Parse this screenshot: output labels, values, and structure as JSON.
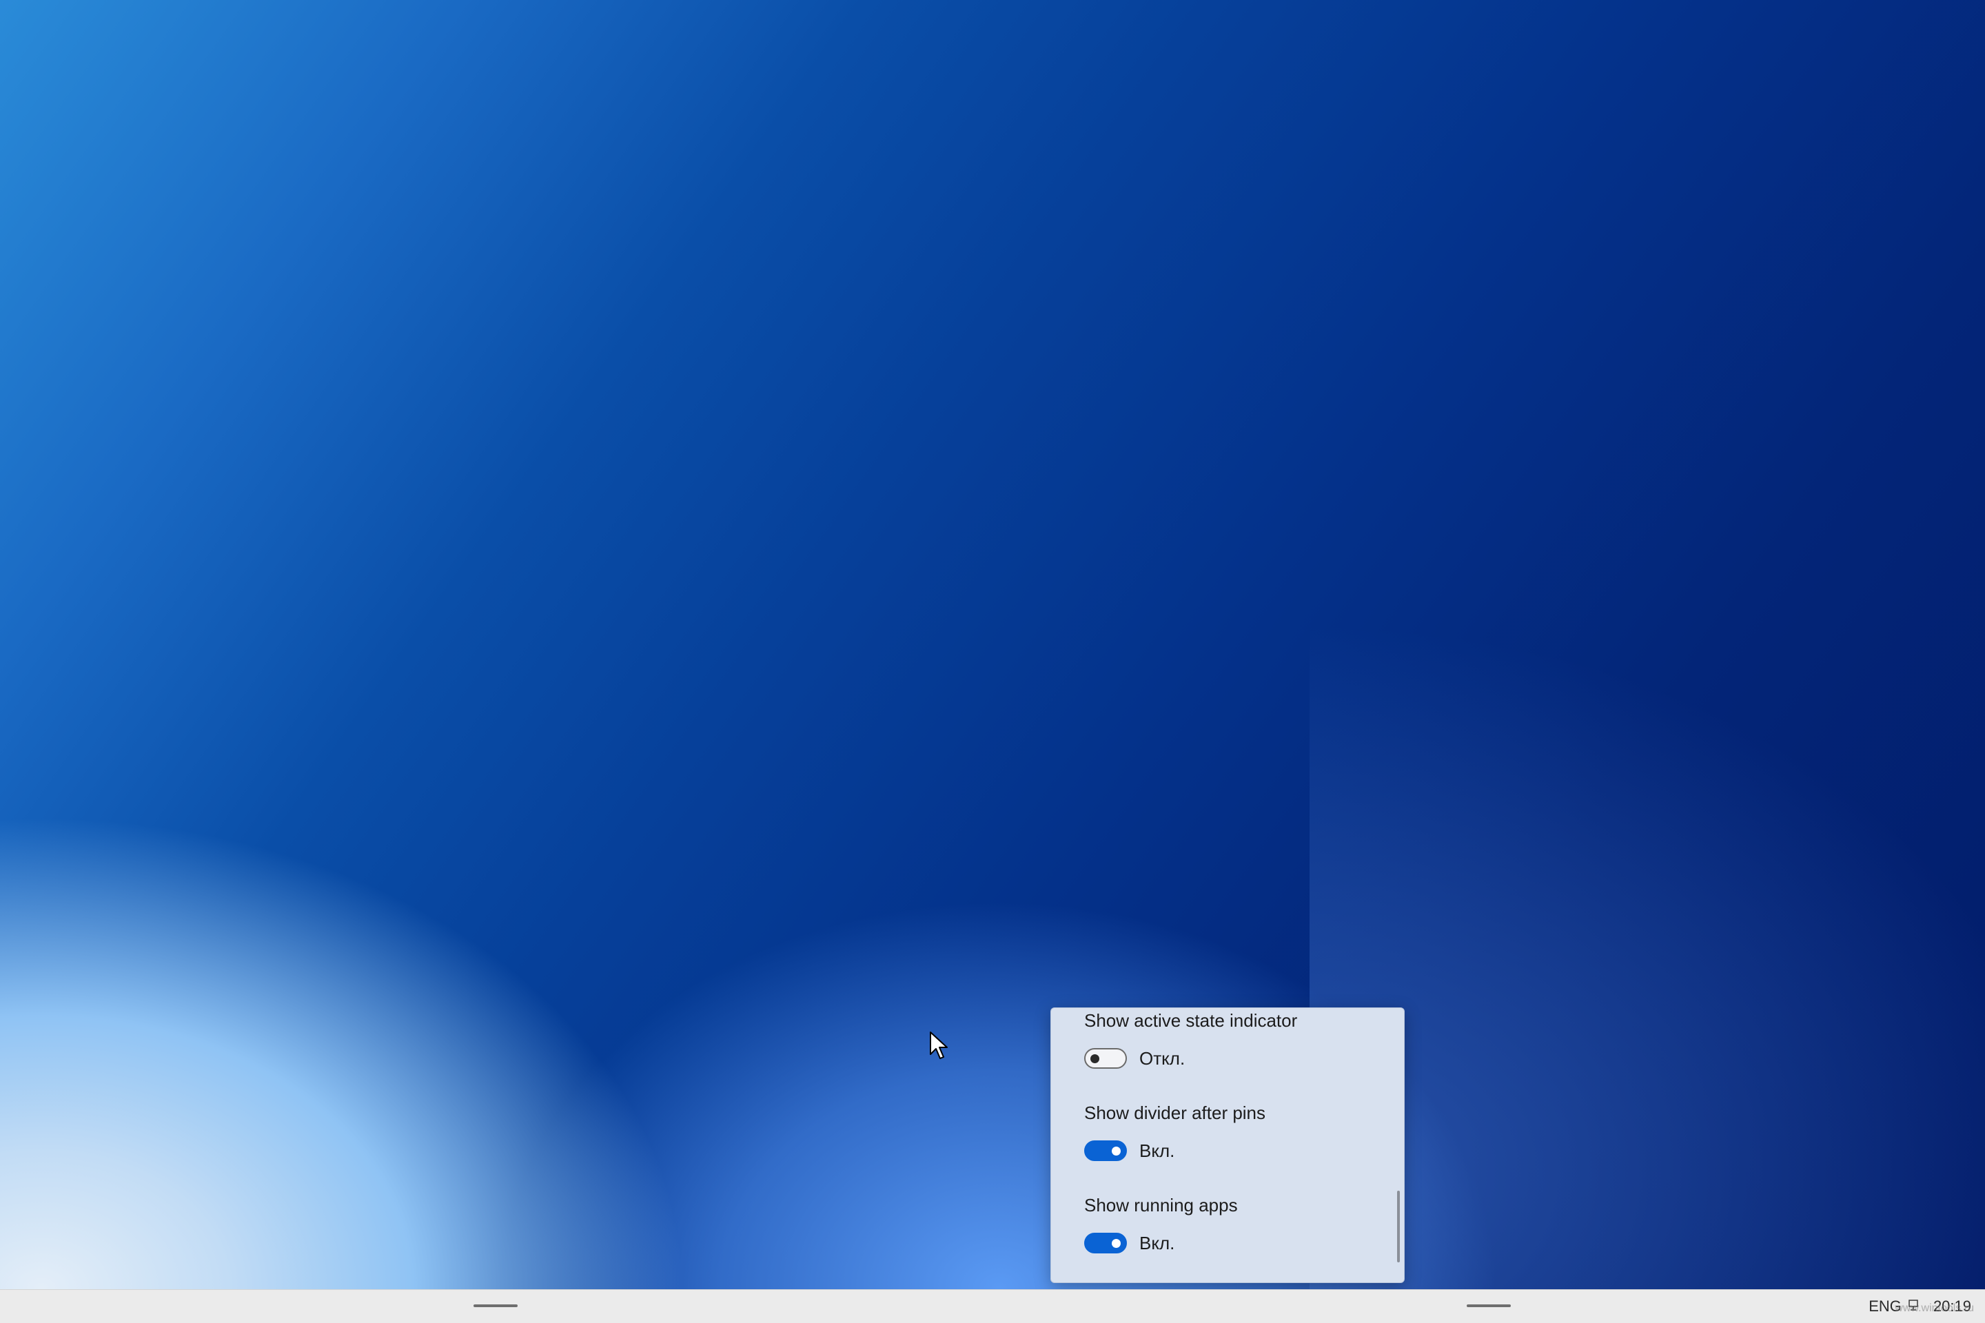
{
  "flyout": {
    "settings": [
      {
        "title": "Show active state indicator",
        "state": "off",
        "state_label": "Откл."
      },
      {
        "title": "Show divider after pins",
        "state": "on",
        "state_label": "Вкл."
      },
      {
        "title": "Show running apps",
        "state": "on",
        "state_label": "Вкл."
      }
    ]
  },
  "taskbar": {
    "language": "ENG",
    "network_icon": "network-icon",
    "time": "20:19",
    "watermark": "www.wintools.ru"
  },
  "colors": {
    "toggle_on": "#0a63d4",
    "flyout_bg": "#d8e1ef",
    "taskbar_bg": "#ebebeb"
  }
}
